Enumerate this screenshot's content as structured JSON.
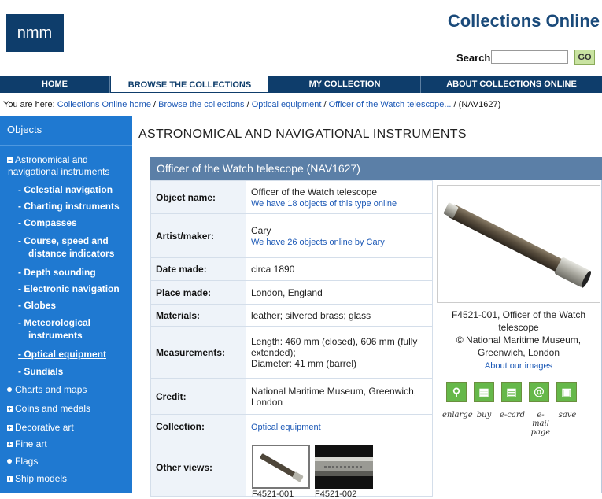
{
  "header": {
    "logo_text": "nmm",
    "site_title": "Collections Online",
    "search_label": "Search",
    "search_value": "",
    "go_label": "GO"
  },
  "nav": [
    {
      "label": "HOME"
    },
    {
      "label": "BROWSE THE COLLECTIONS"
    },
    {
      "label": "MY COLLECTION"
    },
    {
      "label": "ABOUT COLLECTIONS ONLINE"
    }
  ],
  "breadcrumb": {
    "prefix": "You are here: ",
    "links": [
      "Collections Online home",
      "Browse the collections",
      "Optical equipment",
      "Officer of the Watch telescope..."
    ],
    "sep": " / ",
    "current": "(NAV1627)"
  },
  "sidebar": {
    "title": "Objects",
    "top_item_line1": "Astronomical and",
    "top_item_line2": "navigational instruments",
    "sub_items": [
      "- Celestial navigation",
      "- Charting instruments",
      "- Compasses",
      "- Course, speed and",
      "distance indicators",
      "- Depth sounding",
      "- Electronic navigation",
      "- Globes",
      "- Meteorological",
      "instruments",
      "- Optical equipment",
      "- Sundials"
    ],
    "categories": [
      "Charts and maps",
      "Coins and medals",
      "Decorative art",
      "Fine art",
      "Flags",
      "Ship models"
    ]
  },
  "main": {
    "heading": "ASTRONOMICAL AND NAVIGATIONAL INSTRUMENTS",
    "object_title": "Officer of the Watch telescope (NAV1627)",
    "rows": {
      "object_name_label": "Object name:",
      "object_name": "Officer of the Watch telescope",
      "object_name_link": "We have 18 objects of this type online",
      "artist_label": "Artist/maker:",
      "artist": "Cary",
      "artist_link": "We have 26 objects online by Cary",
      "date_label": "Date made:",
      "date": "circa 1890",
      "place_label": "Place made:",
      "place": "London, England",
      "materials_label": "Materials:",
      "materials": "leather; silvered brass; glass",
      "measurements_label": "Measurements:",
      "measurements_1": "Length: 460 mm (closed), 606 mm (fully extended);",
      "measurements_2": "Diameter: 41 mm (barrel)",
      "credit_label": "Credit:",
      "credit": "National Maritime Museum, Greenwich, London",
      "collection_label": "Collection:",
      "collection_link": "Optical equipment",
      "other_views_label": "Other views:"
    },
    "caption_line1": "F4521-001, Officer of the Watch",
    "caption_line2": "telescope",
    "caption_line3": "© National Maritime Museum,",
    "caption_line4": "Greenwich, London",
    "caption_link": "About our images",
    "tools": [
      "enlarge",
      "buy",
      "e-card",
      "e-mail page",
      "save"
    ],
    "other_view_captions": [
      "F4521-001",
      "F4521-002"
    ]
  }
}
